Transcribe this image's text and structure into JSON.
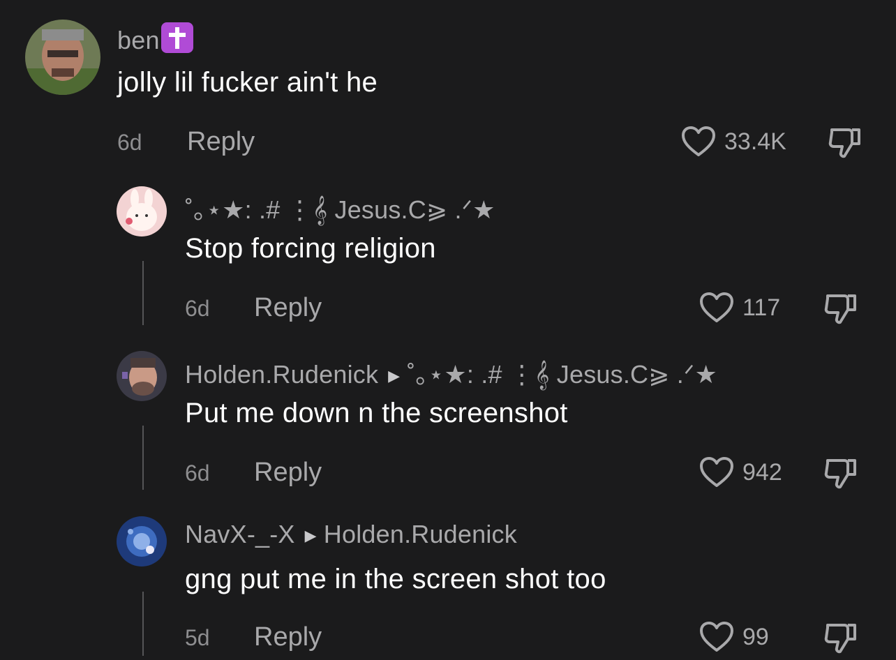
{
  "colors": {
    "background": "#1b1b1c",
    "username": "#a9a9ab",
    "text": "#ffffff",
    "meta": "#8e8e90",
    "badge": "#b04bd6"
  },
  "comments": [
    {
      "username": "ben",
      "badge_icon": "latin-cross-icon",
      "text": "jolly lil fucker ain't he",
      "age": "6d",
      "reply_label": "Reply",
      "likes": "33.4K"
    },
    {
      "username": "˚｡⋆★: .# ⋮𝄞 Jesus.C⪀ .ᐟ★",
      "text": "Stop forcing religion",
      "age": "6d",
      "reply_label": "Reply",
      "likes": "117"
    },
    {
      "username": "Holden.Rudenick",
      "reply_to": "˚｡⋆★: .# ⋮𝄞 Jesus.C⪀ .ᐟ★",
      "text": "Put me down n the screenshot",
      "age": "6d",
      "reply_label": "Reply",
      "likes": "942"
    },
    {
      "username": "NavX-_-X",
      "reply_to": "Holden.Rudenick",
      "text": "gng put me in the screen shot too",
      "age": "5d",
      "reply_label": "Reply",
      "likes": "99"
    }
  ]
}
